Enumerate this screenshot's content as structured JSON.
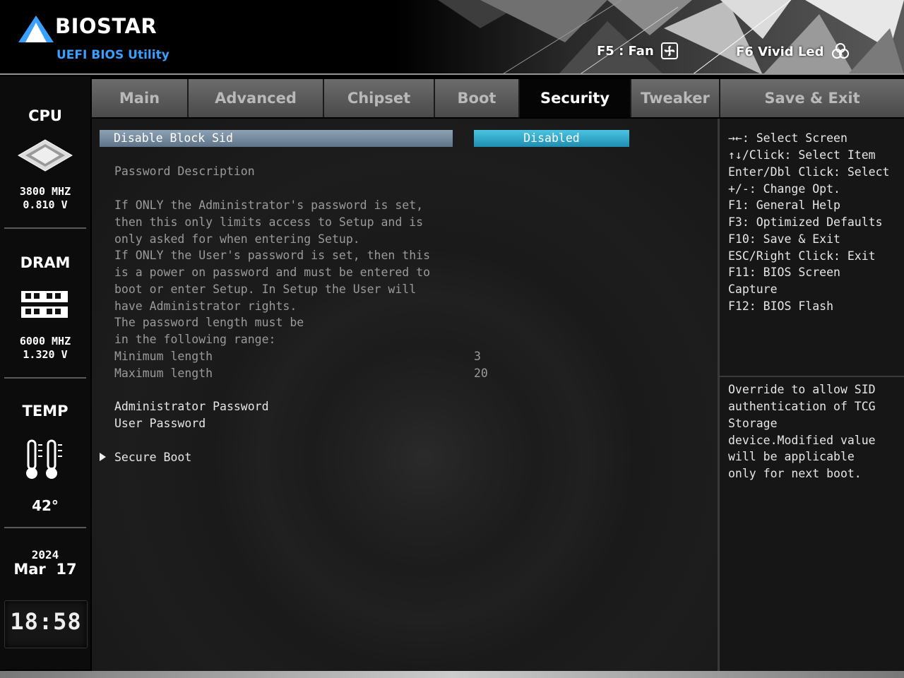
{
  "header": {
    "brand": "BIOSTAR",
    "subtitle": "UEFI BIOS Utility",
    "fan_key": "F5 : Fan",
    "led_key": "F6  Vivid Led"
  },
  "sidebar": {
    "cpu": {
      "title": "CPU",
      "freq": "3800 MHZ",
      "volt": "0.810 V"
    },
    "dram": {
      "title": "DRAM",
      "freq": "6000 MHZ",
      "volt": "1.320 V"
    },
    "temp": {
      "title": "TEMP",
      "value": "42°"
    },
    "date": {
      "year": "2024",
      "month_day": "Mar  17"
    },
    "time": "18:58"
  },
  "tabs": [
    {
      "label": "Main"
    },
    {
      "label": "Advanced"
    },
    {
      "label": "Chipset"
    },
    {
      "label": "Boot"
    },
    {
      "label": "Security"
    },
    {
      "label": "Tweaker"
    },
    {
      "label": "Save & Exit"
    }
  ],
  "main": {
    "selected_item": {
      "label": "Disable Block Sid",
      "value": "Disabled"
    },
    "description_title": "Password Description",
    "description_lines": [
      "If ONLY the Administrator's password is set,",
      "then this only limits access to Setup and is",
      "only asked for when entering Setup.",
      "If ONLY the User's password is set, then this",
      "is a power on password and must be entered to",
      "boot or enter Setup. In Setup the User will",
      "have Administrator rights.",
      "The password length must be",
      "in the following range:"
    ],
    "min_length": {
      "label": "Minimum length",
      "value": "3"
    },
    "max_length": {
      "label": "Maximum length",
      "value": "20"
    },
    "admin_password": "Administrator Password",
    "user_password": "User Password",
    "secure_boot": "Secure Boot"
  },
  "help": {
    "keys": [
      "→←: Select Screen",
      "↑↓/Click: Select Item",
      "Enter/Dbl Click: Select",
      "+/-: Change Opt.",
      "F1: General Help",
      "F3: Optimized Defaults",
      "F10: Save & Exit",
      "ESC/Right Click: Exit",
      "F11: BIOS Screen",
      "Capture",
      "F12: BIOS Flash"
    ],
    "description": [
      "Override to allow SID",
      "authentication of TCG",
      "Storage",
      "device.Modified value",
      "will be applicable",
      "only for next boot."
    ]
  }
}
